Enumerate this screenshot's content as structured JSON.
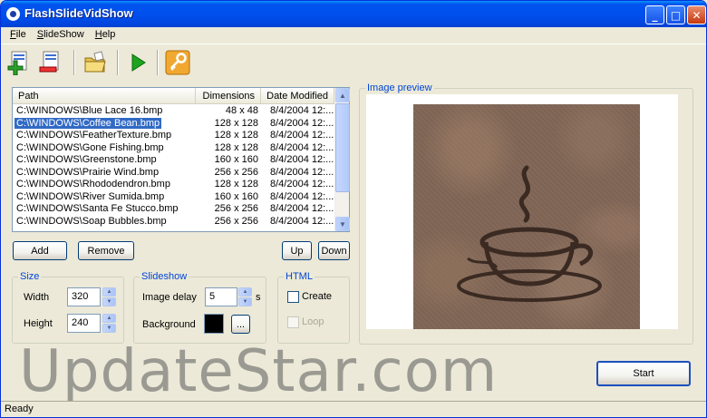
{
  "window": {
    "title": "FlashSlideVidShow",
    "controls": {
      "minimize": "_",
      "maximize": "□",
      "close": "✕"
    }
  },
  "menu": [
    {
      "key": "F",
      "rest": "ile"
    },
    {
      "key": "S",
      "rest": "lideShow"
    },
    {
      "key": "H",
      "rest": "elp"
    }
  ],
  "toolbar": {
    "icons": [
      "add-image-icon",
      "remove-image-icon",
      "open-folder-icon",
      "play-icon",
      "key-icon"
    ]
  },
  "file_list": {
    "columns": [
      "Path",
      "Dimensions",
      "Date Modified"
    ],
    "rows": [
      {
        "path": "C:\\WINDOWS\\Blue Lace 16.bmp",
        "dimensions": "48 x 48",
        "date": "8/4/2004 12:..."
      },
      {
        "path": "C:\\WINDOWS\\Coffee Bean.bmp",
        "dimensions": "128 x 128",
        "date": "8/4/2004 12:..."
      },
      {
        "path": "C:\\WINDOWS\\FeatherTexture.bmp",
        "dimensions": "128 x 128",
        "date": "8/4/2004 12:..."
      },
      {
        "path": "C:\\WINDOWS\\Gone Fishing.bmp",
        "dimensions": "128 x 128",
        "date": "8/4/2004 12:..."
      },
      {
        "path": "C:\\WINDOWS\\Greenstone.bmp",
        "dimensions": "160 x 160",
        "date": "8/4/2004 12:..."
      },
      {
        "path": "C:\\WINDOWS\\Prairie Wind.bmp",
        "dimensions": "256 x 256",
        "date": "8/4/2004 12:..."
      },
      {
        "path": "C:\\WINDOWS\\Rhododendron.bmp",
        "dimensions": "128 x 128",
        "date": "8/4/2004 12:..."
      },
      {
        "path": "C:\\WINDOWS\\River Sumida.bmp",
        "dimensions": "160 x 160",
        "date": "8/4/2004 12:..."
      },
      {
        "path": "C:\\WINDOWS\\Santa Fe Stucco.bmp",
        "dimensions": "256 x 256",
        "date": "8/4/2004 12:..."
      },
      {
        "path": "C:\\WINDOWS\\Soap Bubbles.bmp",
        "dimensions": "256 x 256",
        "date": "8/4/2004 12:..."
      }
    ],
    "selected_index": 1
  },
  "buttons": {
    "add": "Add",
    "remove": "Remove",
    "up": "Up",
    "down": "Down",
    "start": "Start",
    "browse": "..."
  },
  "size_group": {
    "title": "Size",
    "width_label": "Width",
    "width_value": "320",
    "height_label": "Height",
    "height_value": "240"
  },
  "slideshow_group": {
    "title": "Slideshow",
    "delay_label": "Image delay",
    "delay_value": "5",
    "delay_unit": "s",
    "background_label": "Background",
    "background_color": "#000000"
  },
  "html_group": {
    "title": "HTML",
    "create_label": "Create",
    "create_checked": false,
    "loop_label": "Loop",
    "loop_checked": false,
    "loop_enabled": false
  },
  "preview": {
    "title": "Image preview"
  },
  "watermark": "UpdateStar.com",
  "status": "Ready"
}
